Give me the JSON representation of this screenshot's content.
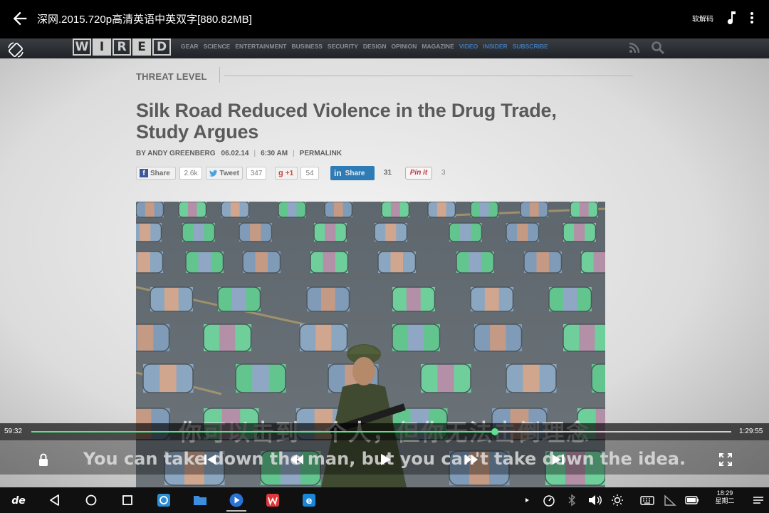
{
  "app": {
    "title": "深网.2015.720p高清英语中英双字[880.82MB]",
    "decoder_label": "软解码"
  },
  "article": {
    "site_logo": "WIRED",
    "nav": [
      "GEAR",
      "SCIENCE",
      "ENTERTAINMENT",
      "BUSINESS",
      "SECURITY",
      "DESIGN",
      "OPINION",
      "MAGAZINE",
      "VIDEO",
      "INSIDER",
      "SUBSCRIBE"
    ],
    "section": "THREAT LEVEL",
    "headline": "Silk Road Reduced Violence in the Drug Trade, Study Argues",
    "author": "BY ANDY GREENBERG",
    "date": "06.02.14",
    "time": "6:30 AM",
    "permalink": "PERMALINK",
    "share": {
      "facebook_label": "Share",
      "facebook_count": "2.6k",
      "twitter_label": "Tweet",
      "twitter_count": "347",
      "gplus_label": "+1",
      "gplus_count": "54",
      "linkedin_label": "Share",
      "linkedin_count": "31",
      "pinterest_label": "Pin it",
      "pinterest_count": "3"
    }
  },
  "subtitles": {
    "chinese": "你可以击到一个人，但你无法击倒理念",
    "english": "You can take down the man, but you can't take down the idea."
  },
  "player": {
    "current_time": "59:32",
    "total_time": "1:29:55",
    "progress": 0.662,
    "accent_color": "#5ce28a"
  },
  "system": {
    "time": "18:29",
    "weekday": "星期二"
  }
}
